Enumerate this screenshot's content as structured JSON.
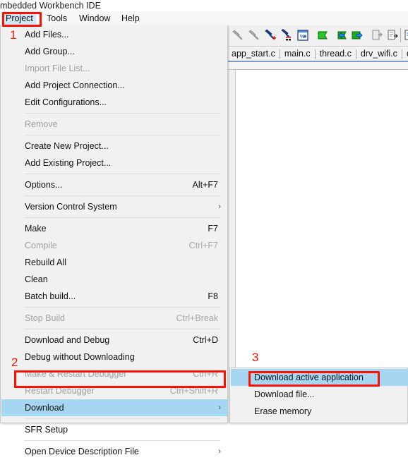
{
  "window": {
    "title": "mbedded Workbench IDE"
  },
  "menubar": {
    "items": [
      {
        "label": "Project",
        "active": true
      },
      {
        "label": "Tools",
        "active": false
      },
      {
        "label": "Window",
        "active": false
      },
      {
        "label": "Help",
        "active": false
      }
    ]
  },
  "toolbar": {
    "icons": [
      "step-over-disabled-icon",
      "step-into-disabled-icon",
      "set-breakpoint-icon",
      "clear-breakpoint-icon",
      "view-breakpoints-icon",
      "go-green-icon",
      "navigate-back-icon",
      "navigate-forward-icon",
      "copy-disabled-icon",
      "paste-icon",
      "compare-icon"
    ]
  },
  "editor_tabs": {
    "tabs": [
      "app_start.c",
      "main.c",
      "thread.c",
      "drv_wifi.c",
      "drv_wla"
    ]
  },
  "project_menu": {
    "items": [
      {
        "label": "Add Files...",
        "accel": "",
        "disabled": false,
        "submenu": false,
        "highlighted": false,
        "sep_before": false
      },
      {
        "label": "Add Group...",
        "accel": "",
        "disabled": false,
        "submenu": false,
        "highlighted": false,
        "sep_before": false
      },
      {
        "label": "Import File List...",
        "accel": "",
        "disabled": true,
        "submenu": false,
        "highlighted": false,
        "sep_before": false
      },
      {
        "label": "Add Project Connection...",
        "accel": "",
        "disabled": false,
        "submenu": false,
        "highlighted": false,
        "sep_before": false
      },
      {
        "label": "Edit Configurations...",
        "accel": "",
        "disabled": false,
        "submenu": false,
        "highlighted": false,
        "sep_before": false
      },
      {
        "label": "Remove",
        "accel": "",
        "disabled": true,
        "submenu": false,
        "highlighted": false,
        "sep_before": true
      },
      {
        "label": "Create New Project...",
        "accel": "",
        "disabled": false,
        "submenu": false,
        "highlighted": false,
        "sep_before": true
      },
      {
        "label": "Add Existing Project...",
        "accel": "",
        "disabled": false,
        "submenu": false,
        "highlighted": false,
        "sep_before": false
      },
      {
        "label": "Options...",
        "accel": "Alt+F7",
        "disabled": false,
        "submenu": false,
        "highlighted": false,
        "sep_before": true
      },
      {
        "label": "Version Control System",
        "accel": "",
        "disabled": false,
        "submenu": true,
        "highlighted": false,
        "sep_before": true
      },
      {
        "label": "Make",
        "accel": "F7",
        "disabled": false,
        "submenu": false,
        "highlighted": false,
        "sep_before": true
      },
      {
        "label": "Compile",
        "accel": "Ctrl+F7",
        "disabled": true,
        "submenu": false,
        "highlighted": false,
        "sep_before": false
      },
      {
        "label": "Rebuild All",
        "accel": "",
        "disabled": false,
        "submenu": false,
        "highlighted": false,
        "sep_before": false
      },
      {
        "label": "Clean",
        "accel": "",
        "disabled": false,
        "submenu": false,
        "highlighted": false,
        "sep_before": false
      },
      {
        "label": "Batch build...",
        "accel": "F8",
        "disabled": false,
        "submenu": false,
        "highlighted": false,
        "sep_before": false
      },
      {
        "label": "Stop Build",
        "accel": "Ctrl+Break",
        "disabled": true,
        "submenu": false,
        "highlighted": false,
        "sep_before": true
      },
      {
        "label": "Download and Debug",
        "accel": "Ctrl+D",
        "disabled": false,
        "submenu": false,
        "highlighted": false,
        "sep_before": true
      },
      {
        "label": "Debug without Downloading",
        "accel": "",
        "disabled": false,
        "submenu": false,
        "highlighted": false,
        "sep_before": false
      },
      {
        "label": "Make & Restart Debugger",
        "accel": "Ctrl+R",
        "disabled": true,
        "submenu": false,
        "highlighted": false,
        "sep_before": false
      },
      {
        "label": "Restart Debugger",
        "accel": "Ctrl+Shift+R",
        "disabled": true,
        "submenu": false,
        "highlighted": false,
        "sep_before": false
      },
      {
        "label": "Download",
        "accel": "",
        "disabled": false,
        "submenu": true,
        "highlighted": true,
        "sep_before": false
      },
      {
        "label": "SFR Setup",
        "accel": "",
        "disabled": false,
        "submenu": false,
        "highlighted": false,
        "sep_before": true
      },
      {
        "label": "Open Device Description File",
        "accel": "",
        "disabled": false,
        "submenu": true,
        "highlighted": false,
        "sep_before": true
      }
    ]
  },
  "download_submenu": {
    "items": [
      {
        "label": "Download active application",
        "highlighted": true
      },
      {
        "label": "Download file...",
        "highlighted": false
      },
      {
        "label": "Erase memory",
        "highlighted": false
      }
    ]
  },
  "annotations": {
    "accent_color": "#fb1200",
    "steps": [
      {
        "number": "1",
        "target": "Project menubar item"
      },
      {
        "number": "2",
        "target": "Download menu item"
      },
      {
        "number": "3",
        "target": "Download active application submenu item"
      }
    ]
  }
}
